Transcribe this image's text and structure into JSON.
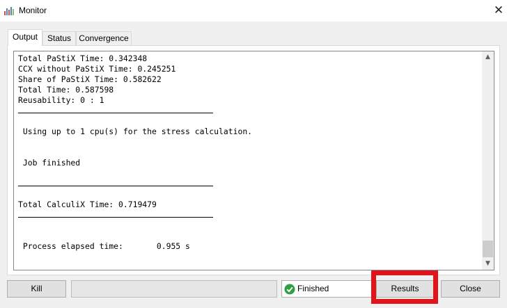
{
  "window": {
    "title": "Monitor",
    "close_glyph": "✕",
    "icon": "chart-app-icon"
  },
  "tabs": [
    {
      "label": "Output",
      "active": true
    },
    {
      "label": "Status",
      "active": false
    },
    {
      "label": "Convergence",
      "active": false
    }
  ],
  "output": {
    "lines": [
      {
        "kind": "text",
        "text": "Total PaStiX Time: 0.342348"
      },
      {
        "kind": "text",
        "text": "CCX without PaStiX Time: 0.245251"
      },
      {
        "kind": "text",
        "text": "Share of PaStiX Time: 0.582622"
      },
      {
        "kind": "text",
        "text": "Total Time: 0.587598"
      },
      {
        "kind": "text",
        "text": "Reusability: 0 : 1"
      },
      {
        "kind": "separator",
        "text": ""
      },
      {
        "kind": "text",
        "text": ""
      },
      {
        "kind": "text",
        "text": " Using up to 1 cpu(s) for the stress calculation."
      },
      {
        "kind": "text",
        "text": ""
      },
      {
        "kind": "text",
        "text": ""
      },
      {
        "kind": "text",
        "text": " Job finished"
      },
      {
        "kind": "text",
        "text": ""
      },
      {
        "kind": "separator",
        "text": ""
      },
      {
        "kind": "text",
        "text": ""
      },
      {
        "kind": "text",
        "text": "Total CalculiX Time: 0.719479"
      },
      {
        "kind": "separator",
        "text": ""
      },
      {
        "kind": "text",
        "text": ""
      },
      {
        "kind": "text",
        "text": ""
      },
      {
        "kind": "text",
        "text": " Process elapsed time:       0.955 s"
      }
    ]
  },
  "buttons": {
    "kill": "Kill",
    "results": "Results",
    "close": "Close"
  },
  "status": {
    "text": "Finished",
    "icon": "check-circle-icon",
    "color": "#2ea043"
  },
  "progress": {
    "fraction": 0
  },
  "highlight": {
    "target": "results-button",
    "color": "#e1141b"
  }
}
